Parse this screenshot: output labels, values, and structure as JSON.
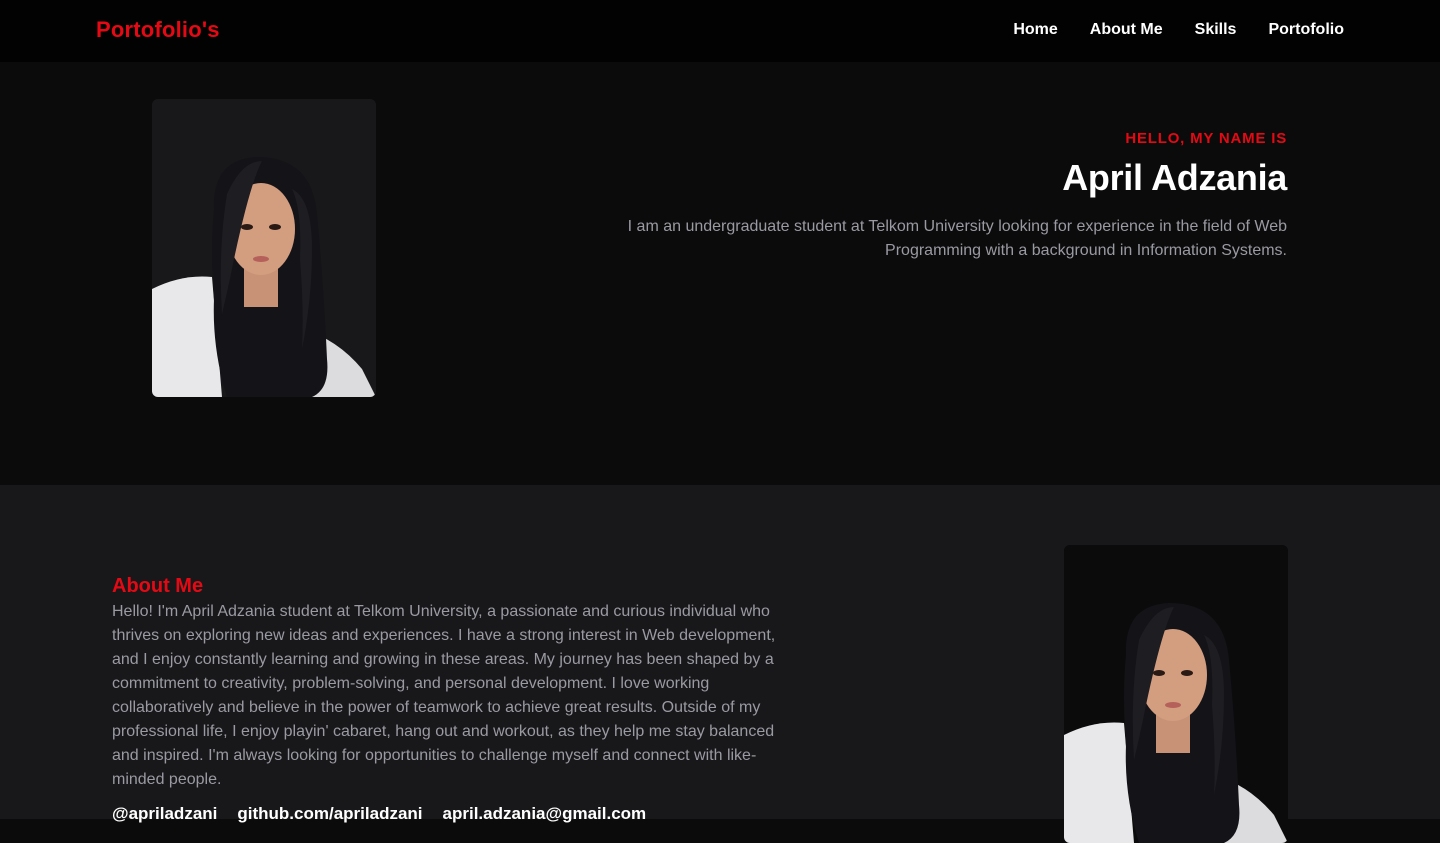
{
  "navbar": {
    "brand": "Portofolio's",
    "links": [
      "Home",
      "About Me",
      "Skills",
      "Portofolio"
    ]
  },
  "hero": {
    "greeting": "HELLO, MY NAME IS",
    "name": "April Adzania",
    "description": "I am an undergraduate student at Telkom University looking for experience in the field of Web Programming with a background in Information Systems."
  },
  "about": {
    "title": "About Me",
    "body": "Hello! I'm April Adzania student at Telkom University, a passionate and curious individual who thrives on exploring new ideas and experiences. I have a strong interest in Web development, and I enjoy constantly learning and growing in these areas. My journey has been shaped by a commitment to creativity, problem-solving, and personal development. I love working collaboratively and believe in the power of teamwork to achieve great results. Outside of my professional life, I enjoy playin' cabaret, hang out and workout, as they help me stay balanced and inspired. I'm always looking for opportunities to challenge myself and connect with like-minded people.",
    "contacts": [
      "@apriladzani",
      "github.com/apriladzani",
      "april.adzania@gmail.com"
    ]
  },
  "colors": {
    "accent": "#e50914",
    "nav_bg": "#020203",
    "hero_bg": "#0b0b0c",
    "about_bg": "#18181b",
    "muted_text": "#9a9aa2"
  }
}
